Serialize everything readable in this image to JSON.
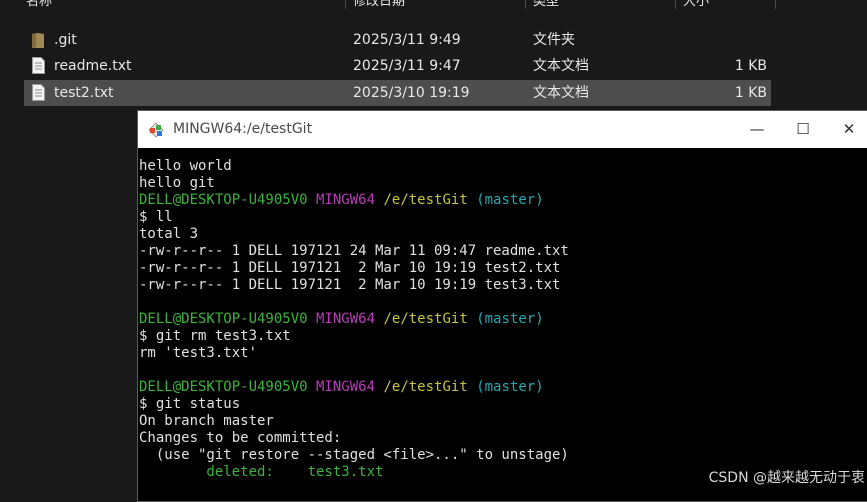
{
  "explorer": {
    "columns": [
      "名称",
      "修改日期",
      "类型",
      "大小"
    ],
    "rows": [
      {
        "name": ".git",
        "date": "2025/3/11 9:49",
        "type": "文件夹",
        "size": "",
        "icon": "folder-icon"
      },
      {
        "name": "readme.txt",
        "date": "2025/3/11 9:47",
        "type": "文本文档",
        "size": "1 KB",
        "icon": "text-file-icon"
      },
      {
        "name": "test2.txt",
        "date": "2025/3/10 19:19",
        "type": "文本文档",
        "size": "1 KB",
        "icon": "text-file-icon",
        "selected": true
      }
    ]
  },
  "terminal": {
    "title": "MINGW64:/e/testGit",
    "controls": {
      "minimize": "—",
      "maximize": "☐",
      "close": "✕"
    },
    "prompt": {
      "user": "DELL@DESKTOP-U4905V0",
      "host": "MINGW64",
      "path": "/e/testGit",
      "branch": "(master)"
    },
    "lines": {
      "l1": "hello world",
      "l2": "hello git",
      "cmd1": "$ ll",
      "out1": "total 3",
      "out2": "-rw-r--r-- 1 DELL 197121 24 Mar 11 09:47 readme.txt",
      "out3": "-rw-r--r-- 1 DELL 197121  2 Mar 10 19:19 test2.txt",
      "out4": "-rw-r--r-- 1 DELL 197121  2 Mar 10 19:19 test3.txt",
      "cmd2": "$ git rm test3.txt",
      "out5": "rm 'test3.txt'",
      "cmd3": "$ git status",
      "out6": "On branch master",
      "out7": "Changes to be committed:",
      "out8": "  (use \"git restore --staged <file>...\" to unstage)",
      "deleted_label": "        deleted:    ",
      "deleted_file": "test3.txt"
    }
  },
  "watermark": "CSDN @越来越无动于衷",
  "colors": {
    "prompt_user": "#3cb43c",
    "prompt_host": "#b63db6",
    "prompt_path": "#c7c43d",
    "prompt_branch": "#2aa6b0"
  }
}
